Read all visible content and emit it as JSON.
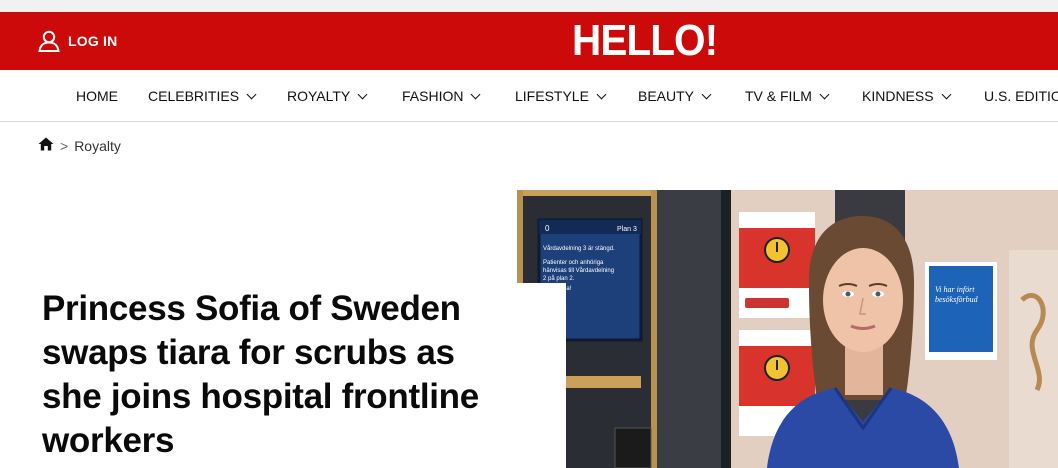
{
  "header": {
    "login_label": "LOG IN",
    "logo_text": "HELLO!",
    "brand_color": "#cc0a0a",
    "login_icon": "user-icon"
  },
  "nav": {
    "items": [
      {
        "label": "HOME",
        "has_dropdown": false
      },
      {
        "label": "CELEBRITIES",
        "has_dropdown": true
      },
      {
        "label": "ROYALTY",
        "has_dropdown": true
      },
      {
        "label": "FASHION",
        "has_dropdown": true
      },
      {
        "label": "LIFESTYLE",
        "has_dropdown": true
      },
      {
        "label": "BEAUTY",
        "has_dropdown": true
      },
      {
        "label": "TV & FILM",
        "has_dropdown": true
      },
      {
        "label": "KINDNESS",
        "has_dropdown": true
      },
      {
        "label": "U.S. EDITIO",
        "has_dropdown": false
      }
    ]
  },
  "breadcrumb": {
    "home_icon": "home-icon",
    "separator": ">",
    "current": "Royalty"
  },
  "article": {
    "headline": "Princess Sofia of Sweden swaps tiara for scrubs as she joins hospital frontline workers"
  },
  "photo": {
    "sign_left_header_left": "0",
    "sign_left_header_right": "Plan 3",
    "sign_left_line1": "Vårdavdelning 3 är stängd.",
    "sign_left_line2": "Patienter och anhöriga",
    "sign_left_line3": "hänvisas till Vårdavdelning",
    "sign_left_line4": "2 på plan 2.",
    "sign_left_line5": "Välkomna!",
    "sign_right_line1": "Vi har infört",
    "sign_right_line2": "besöksförbud"
  }
}
